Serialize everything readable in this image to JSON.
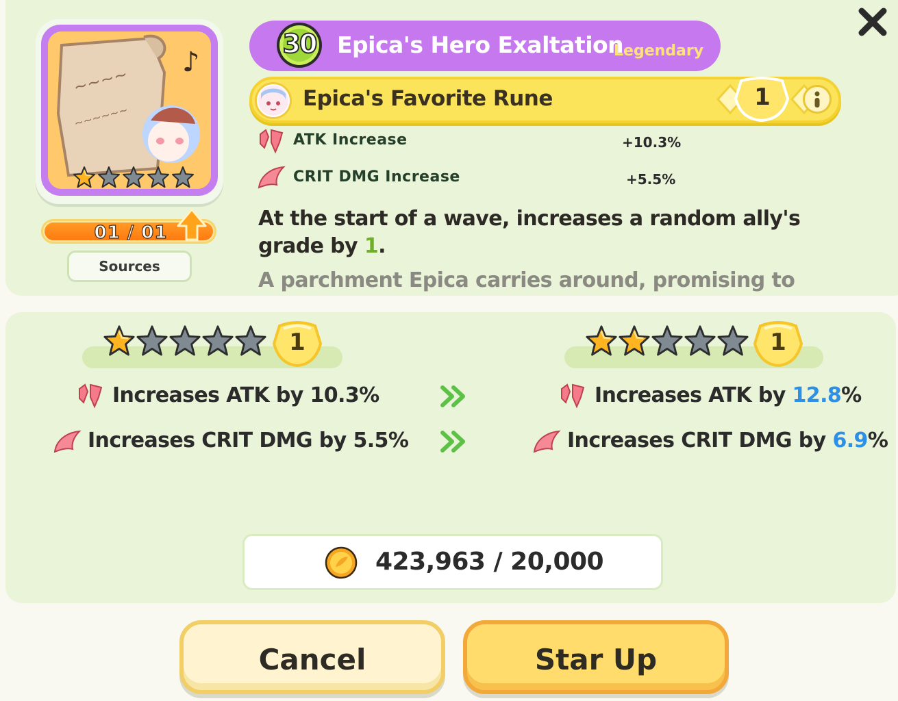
{
  "window": {
    "close_icon": "close-x-icon"
  },
  "item": {
    "level": "30",
    "title": "Epica's Hero Exaltation",
    "rarity": "Legendary",
    "card_stars_filled": 1,
    "card_stars_total": 5,
    "count_text": "01 / 01",
    "count_fill_fraction": 1.0,
    "sources_label": "Sources"
  },
  "rune": {
    "name": "Epica's Favorite Rune",
    "count": "1"
  },
  "stats": [
    {
      "icon": "atk-wing-icon",
      "label": "ATK Increase",
      "value": "+10.3%"
    },
    {
      "icon": "crit-dmg-icon",
      "label": "CRIT DMG Increase",
      "value": "+5.5%"
    }
  ],
  "description": {
    "effect_prefix": "At the start of a wave, increases a random ally's grade by ",
    "effect_value": "1",
    "effect_suffix": ".",
    "flavor": "A parchment Epica carries around, promising to"
  },
  "comparison": {
    "current": {
      "stars_filled": 1,
      "stars_total": 5,
      "grade": "1",
      "atk_prefix": "Increases ATK by 10.3%",
      "crit_prefix": "Increases CRIT DMG by 5.5%"
    },
    "next": {
      "stars_filled": 2,
      "stars_total": 5,
      "grade": "1",
      "atk_prefix": "Increases ATK by ",
      "atk_value": "12.8",
      "atk_suffix": "%",
      "crit_prefix": "Increases CRIT DMG by ",
      "crit_value": "6.9",
      "crit_suffix": "%"
    }
  },
  "cost": {
    "icon": "gold-coin-icon",
    "text": "423,963 / 20,000"
  },
  "buttons": {
    "cancel": "Cancel",
    "star_up": "Star Up"
  },
  "colors": {
    "panel_bg": "#eaf4d8",
    "title_banner": "#c679ee",
    "rune_bar": "#fbe45a",
    "upgrade_blue": "#2e8fe6",
    "grade_green": "#6fae28"
  }
}
